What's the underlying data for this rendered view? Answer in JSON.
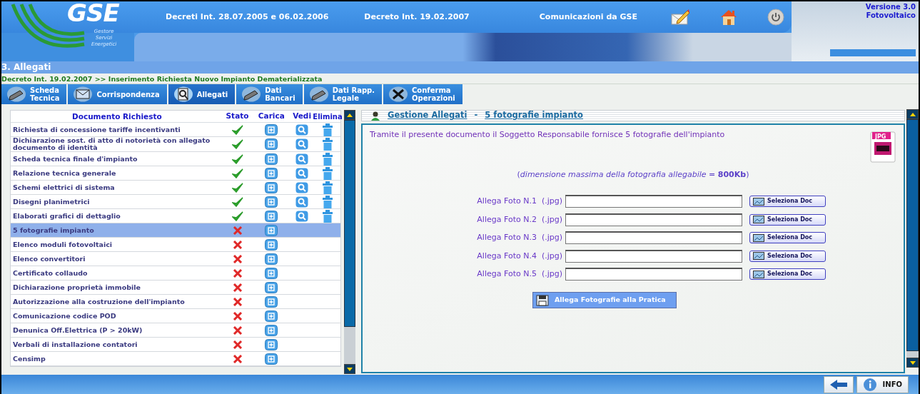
{
  "header": {
    "logo_text": "GSE",
    "logo_subtitle": [
      "Gestore",
      "Servizi",
      "Energetici"
    ],
    "nav_links": [
      "Decreti Int. 28.07.2005 e 06.02.2006",
      "Decreto Int. 19.02.2007",
      "Comunicazioni da GSE"
    ],
    "version": [
      "Versione 3.0",
      "Fotovoltaico"
    ]
  },
  "section_title": "3. Allegati",
  "breadcrumb": "Decreto Int. 19.02.2007 >> Inserimento Richiesta Nuovo Impianto Dematerializzata",
  "tabs": [
    {
      "label": [
        "Scheda",
        "Tecnica"
      ],
      "kind": "pencil",
      "selected": false
    },
    {
      "label": [
        "Corrispondenza"
      ],
      "kind": "mail",
      "selected": false
    },
    {
      "label": [
        "Allegati"
      ],
      "kind": "search",
      "selected": true
    },
    {
      "label": [
        "Dati",
        "Bancari"
      ],
      "kind": "pencil",
      "selected": false
    },
    {
      "label": [
        "Dati Rapp.",
        "Legale"
      ],
      "kind": "pencil",
      "selected": false
    },
    {
      "label": [
        "Conferma",
        "Operazioni"
      ],
      "kind": "tools",
      "selected": false
    }
  ],
  "documents": {
    "columns": [
      "Documento Richiesto",
      "Stato",
      "Carica",
      "Vedi",
      "Elimina"
    ],
    "rows": [
      {
        "name": "Richiesta di concessione tariffe incentivanti",
        "uploaded": true,
        "selected": false
      },
      {
        "name": "Dichiarazione sost. di atto di notorietà con allegato documento di identità",
        "uploaded": true,
        "selected": false
      },
      {
        "name": "Scheda tecnica finale d'impianto",
        "uploaded": true,
        "selected": false
      },
      {
        "name": "Relazione tecnica generale",
        "uploaded": true,
        "selected": false
      },
      {
        "name": "Schemi elettrici di sistema",
        "uploaded": true,
        "selected": false
      },
      {
        "name": "Disegni planimetrici",
        "uploaded": true,
        "selected": false
      },
      {
        "name": "Elaborati grafici di dettaglio",
        "uploaded": true,
        "selected": false
      },
      {
        "name": "5 fotografie impianto",
        "uploaded": false,
        "selected": true
      },
      {
        "name": "Elenco moduli fotovoltaici",
        "uploaded": false,
        "selected": false
      },
      {
        "name": "Elenco convertitori",
        "uploaded": false,
        "selected": false
      },
      {
        "name": "Certificato collaudo",
        "uploaded": false,
        "selected": false
      },
      {
        "name": "Dichiarazione proprietà immobile",
        "uploaded": false,
        "selected": false
      },
      {
        "name": "Autorizzazione alla costruzione dell'impianto",
        "uploaded": false,
        "selected": false
      },
      {
        "name": "Comunicazione codice POD",
        "uploaded": false,
        "selected": false
      },
      {
        "name": "Denunica Off.Elettrica (P > 20kW)",
        "uploaded": false,
        "selected": false
      },
      {
        "name": "Verbali di installazione contatori",
        "uploaded": false,
        "selected": false
      },
      {
        "name": "Censimp",
        "uploaded": false,
        "selected": false
      }
    ]
  },
  "panel": {
    "title": "Gestione Allegati",
    "separator": "-",
    "subtitle": "5 fotografie impianto",
    "description": "Tramite il presente documento il Soggetto Responsabile fornisce 5 fotografie dell'impianto",
    "file_badge": "JPG",
    "size_note": "(*dimensione massima della fotografia allegabile =* **800Kb**)",
    "uploads": [
      {
        "label": "Allega Foto N.1  (.jpg)",
        "button": "Seleziona Doc"
      },
      {
        "label": "Allega Foto N.2  (.jpg)",
        "button": "Seleziona Doc"
      },
      {
        "label": "Allega Foto N.3  (.jpg)",
        "button": "Seleziona Doc"
      },
      {
        "label": "Allega Foto N.4  (.jpg)",
        "button": "Seleziona Doc"
      },
      {
        "label": "Allega Foto N.5  (.jpg)",
        "button": "Seleziona Doc"
      }
    ],
    "submit": "Allega Fotografie alla Pratica"
  },
  "footer": {
    "info_button": "INFO"
  }
}
